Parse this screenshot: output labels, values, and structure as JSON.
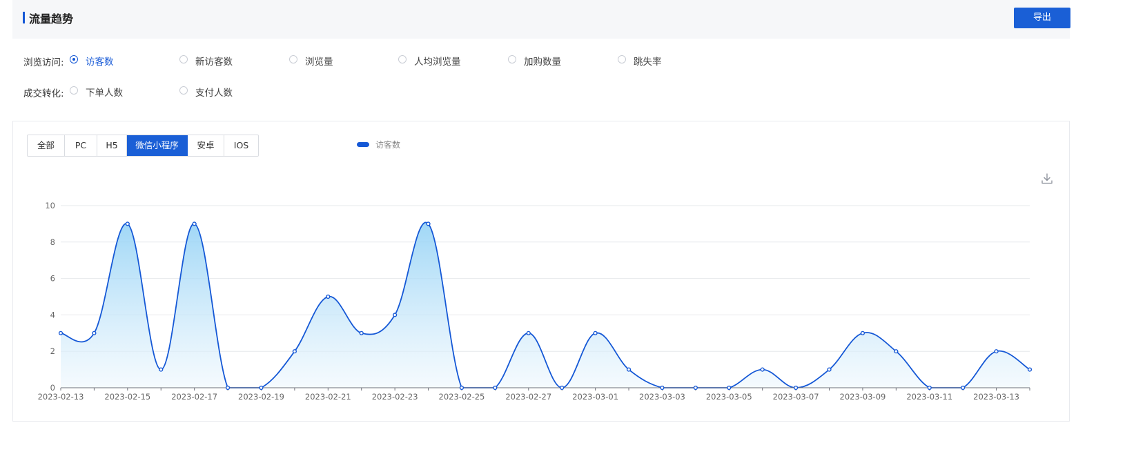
{
  "header": {
    "title": "流量趋势",
    "export_label": "导出"
  },
  "filters": {
    "browse": {
      "label": "浏览访问:",
      "options": [
        "访客数",
        "新访客数",
        "浏览量",
        "人均浏览量",
        "加购数量",
        "跳失率"
      ],
      "selected": "访客数"
    },
    "conversion": {
      "label": "成交转化:",
      "options": [
        "下单人数",
        "支付人数"
      ],
      "selected": ""
    }
  },
  "platform_tabs": {
    "items": [
      "全部",
      "PC",
      "H5",
      "微信小程序",
      "安卓",
      "IOS"
    ],
    "active": "微信小程序"
  },
  "legend": {
    "label": "访客数",
    "color": "#1558d6"
  },
  "download_icon": "download-icon",
  "colors": {
    "accent": "#1558d6",
    "area_top": "#8fd0f5",
    "area_bottom": "#eef7fd"
  },
  "chart_data": {
    "type": "area",
    "title": "",
    "xlabel": "",
    "ylabel": "",
    "ylim": [
      0,
      10
    ],
    "yticks": [
      0,
      2,
      4,
      6,
      8,
      10
    ],
    "grid": true,
    "smooth": true,
    "legend_position": "top-center",
    "x": [
      "2023-02-13",
      "2023-02-14",
      "2023-02-15",
      "2023-02-16",
      "2023-02-17",
      "2023-02-18",
      "2023-02-19",
      "2023-02-20",
      "2023-02-21",
      "2023-02-22",
      "2023-02-23",
      "2023-02-24",
      "2023-02-25",
      "2023-02-26",
      "2023-02-27",
      "2023-02-28",
      "2023-03-01",
      "2023-03-02",
      "2023-03-03",
      "2023-03-04",
      "2023-03-05",
      "2023-03-06",
      "2023-03-07",
      "2023-03-08",
      "2023-03-09",
      "2023-03-10",
      "2023-03-11",
      "2023-03-12",
      "2023-03-13",
      "2023-03-14"
    ],
    "x_tick_labels": [
      "2023-02-13",
      "2023-02-15",
      "2023-02-17",
      "2023-02-19",
      "2023-02-21",
      "2023-02-23",
      "2023-02-25",
      "2023-02-27",
      "2023-03-01",
      "2023-03-03",
      "2023-03-05",
      "2023-03-07",
      "2023-03-09",
      "2023-03-11",
      "2023-03-13"
    ],
    "series": [
      {
        "name": "访客数",
        "values": [
          3,
          3,
          9,
          1,
          9,
          0,
          0,
          2,
          5,
          3,
          4,
          9,
          0,
          0,
          3,
          0,
          3,
          1,
          0,
          0,
          0,
          1,
          0,
          1,
          3,
          2,
          0,
          0,
          2,
          1
        ]
      }
    ]
  }
}
